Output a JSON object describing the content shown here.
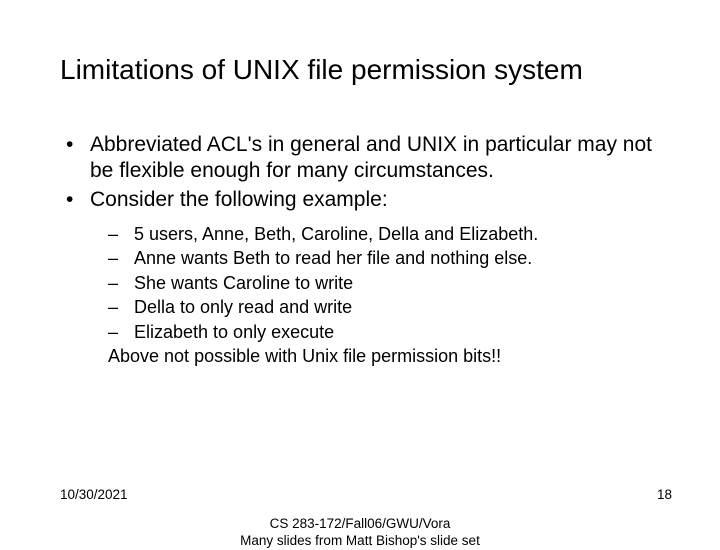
{
  "title": "Limitations of UNIX file permission system",
  "bullets": {
    "b0": "Abbreviated ACL's in general and UNIX in particular may not be flexible enough for many circumstances.",
    "b1": "Consider the following example:",
    "sub": {
      "s0": "5 users, Anne, Beth, Caroline, Della and Elizabeth.",
      "s1": "Anne wants Beth to read her file and nothing else.",
      "s2": "She wants Caroline to write",
      "s3": "Della to only read and write",
      "s4": "Elizabeth to only execute",
      "s5": "Above not possible with Unix file permission bits!!"
    }
  },
  "footer": {
    "date": "10/30/2021",
    "center_line1": "CS 283-172/Fall06/GWU/Vora",
    "center_line2": "Many slides from Matt Bishop's slide set",
    "page": "18"
  }
}
